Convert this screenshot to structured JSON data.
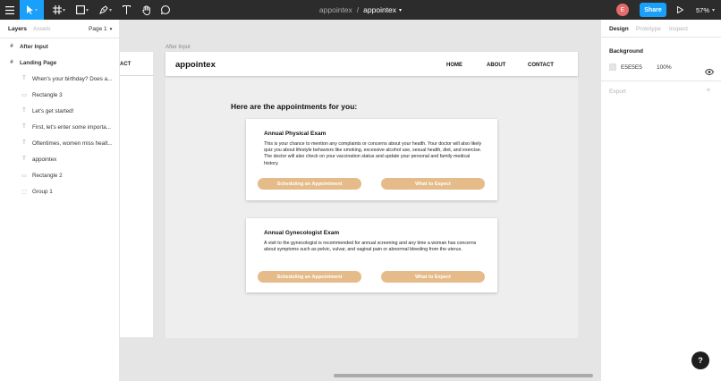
{
  "toolbar": {
    "project": "appointex",
    "separator": "/",
    "file": "appointex",
    "avatar_initial": "E",
    "share_label": "Share",
    "zoom": "57%"
  },
  "left_panel": {
    "tab_layers": "Layers",
    "tab_assets": "Assets",
    "page_selector": "Page 1",
    "layers": [
      {
        "label": "After Input",
        "kind": "frame"
      },
      {
        "label": "Landing Page",
        "kind": "frame"
      },
      {
        "label": "When's your birthday? Does a...",
        "kind": "text"
      },
      {
        "label": "Rectangle 3",
        "kind": "rect"
      },
      {
        "label": "Let's get started!",
        "kind": "text"
      },
      {
        "label": "First, let's enter some importa...",
        "kind": "text"
      },
      {
        "label": "Oftentimes, women miss healt...",
        "kind": "text"
      },
      {
        "label": "appointex",
        "kind": "text"
      },
      {
        "label": "Rectangle 2",
        "kind": "rect"
      },
      {
        "label": "Group 1",
        "kind": "group"
      }
    ]
  },
  "canvas": {
    "side_frame_contact": "ACT",
    "frame_label": "After Input",
    "logo": "appointex",
    "nav": [
      "HOME",
      "ABOUT",
      "CONTACT"
    ],
    "heading": "Here are the appointments for you:",
    "cards": [
      {
        "title": "Annual Physical Exam",
        "body": "This is your chance to mention any complaints or concerns about your health. Your doctor will also likely quiz you about lifestyle behaviors like smoking, excessive alcohol use, sexual health, diet, and exercise. The doctor will also check on your vaccination status and update your personal and family medical history.",
        "btn1": "Scheduling an Appointment",
        "btn2": "What to Expect"
      },
      {
        "title": "Annual Gynecologist Exam",
        "body": "A visit to the gynecologist is recommended for annual screening and any time a woman has concerns about symptoms such as pelvic, vulvar, and vaginal pain or abnormal bleeding from the uterus.",
        "btn1": "Scheduling an Appointment",
        "btn2": "What to Expect"
      }
    ]
  },
  "right_panel": {
    "tab_design": "Design",
    "tab_prototype": "Prototype",
    "tab_inspect": "Inspect",
    "background_title": "Background",
    "bg_hex": "E5E5E5",
    "bg_opacity": "100%",
    "export_title": "Export",
    "export_add": "+"
  },
  "help": "?",
  "colors": {
    "toolbar": "#2c2c2c",
    "accent": "#18a0fb",
    "button": "#e6bb8a",
    "canvas": "#e5e5e5"
  }
}
